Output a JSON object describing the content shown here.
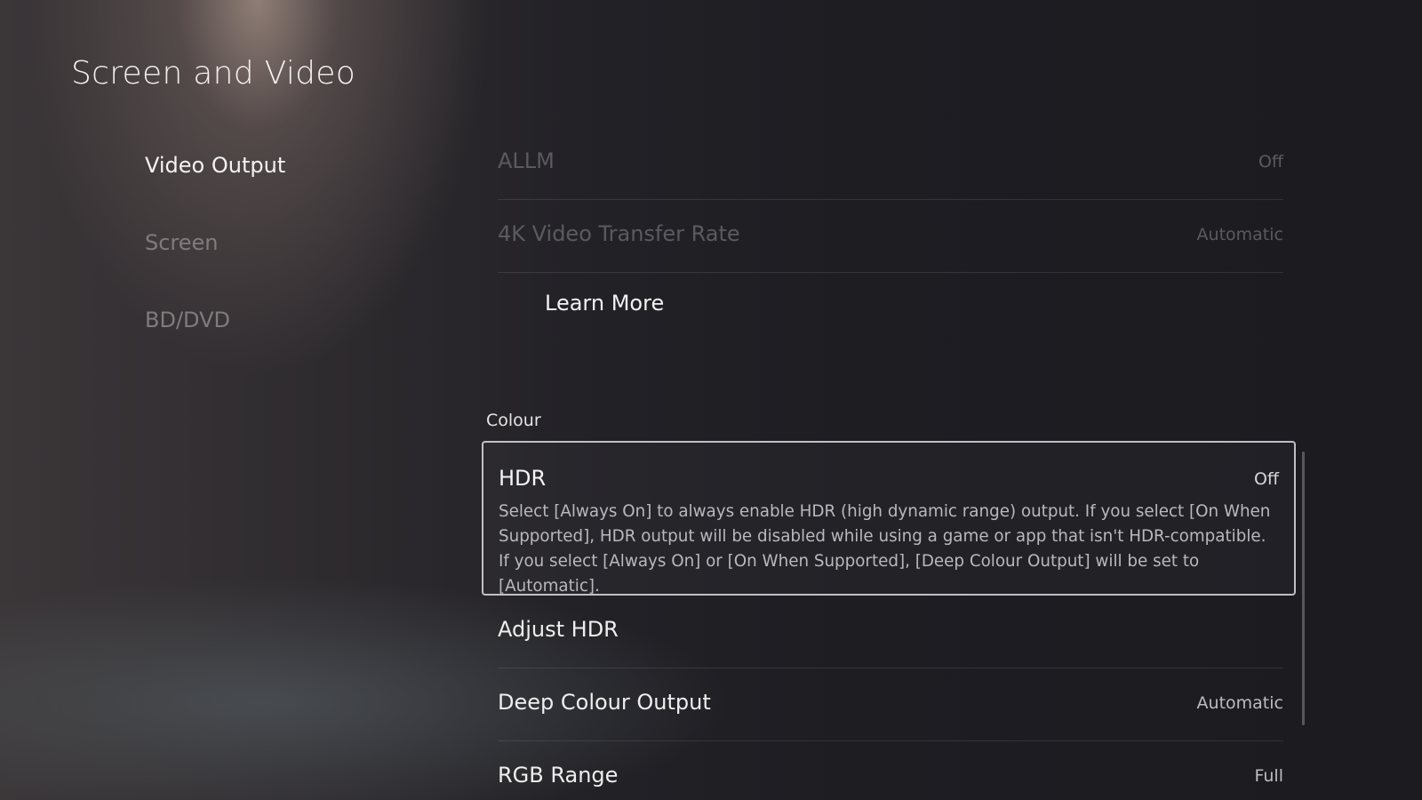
{
  "page": {
    "title": "Screen and Video"
  },
  "sidebar": {
    "items": [
      {
        "label": "Video Output",
        "active": true
      },
      {
        "label": "Screen",
        "active": false
      },
      {
        "label": "BD/DVD",
        "active": false
      }
    ]
  },
  "settings_top": {
    "rows": [
      {
        "label": "ALLM",
        "value": "Off"
      },
      {
        "label": "4K Video Transfer Rate",
        "value": "Automatic"
      }
    ],
    "learn_more_label": "Learn More"
  },
  "colour_section": {
    "heading": "Colour",
    "focused": {
      "label": "HDR",
      "value": "Off",
      "description": "Select [Always On] to always enable HDR (high dynamic range) output. If you select [On When Supported], HDR output will be disabled while using a game or app that isn't HDR-compatible. If you select [Always On] or [On When Supported], [Deep Colour Output] will be set to [Automatic]."
    },
    "rows": [
      {
        "label": "Adjust HDR",
        "value": ""
      },
      {
        "label": "Deep Colour Output",
        "value": "Automatic"
      },
      {
        "label": "RGB Range",
        "value": "Full"
      }
    ]
  },
  "colors": {
    "focus_border": "#dcdce1",
    "text_primary": "#f4f4f4",
    "text_dim": "#7f7c7e"
  }
}
